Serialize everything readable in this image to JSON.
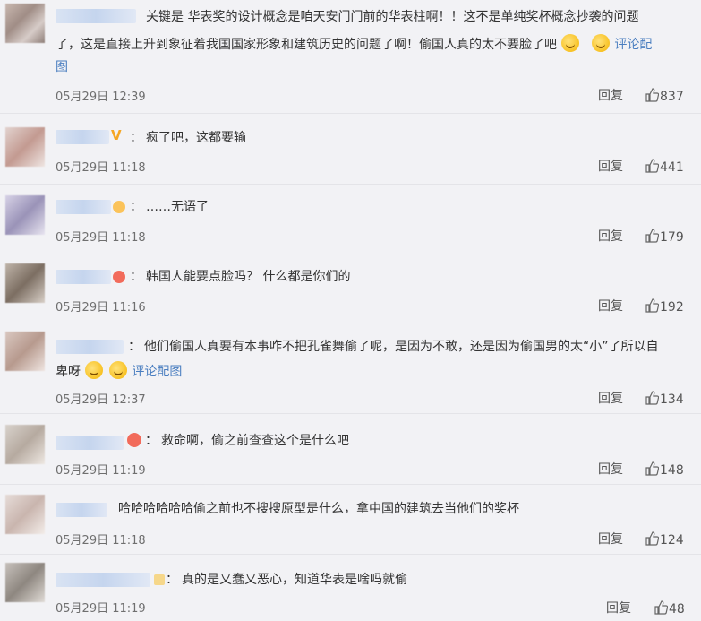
{
  "comments": [
    {
      "text": "关键是 华表奖的设计概念是咱天安门门前的华表柱啊！！这不是单纯奖杯概念抄袭的问题了，这是直接上升到象征着我国国家形象和建筑历史的问题了啊！偷国人真的太不要脸了吧",
      "line1": "关键是 华表奖的设计概念是咱天安门门前的华表柱啊！！这不是单纯奖杯概念抄袭的问题",
      "line2": "了，这是直接上升到象征着我国国家形象和建筑历史的问题了啊！偷国人真的太不要脸了吧",
      "pic_link_a": "评论配",
      "pic_link_b": "图",
      "time": "05月29日 12:39",
      "reply": "回复",
      "likes": "837"
    },
    {
      "prefix": "：",
      "text": "疯了吧，这都要输",
      "time": "05月29日 11:18",
      "reply": "回复",
      "likes": "441"
    },
    {
      "prefix": "：",
      "text": "……无语了",
      "time": "05月29日 11:18",
      "reply": "回复",
      "likes": "179"
    },
    {
      "prefix": "：",
      "text": "韩国人能要点脸吗？ 什么都是你们的",
      "time": "05月29日 11:16",
      "reply": "回复",
      "likes": "192"
    },
    {
      "prefix": "：",
      "line1": "他们偷国人真要有本事咋不把孔雀舞偷了呢，是因为不敢，还是因为偷国男的太“小”了所以自",
      "line2": "卑呀",
      "pic_link": "评论配图",
      "time": "05月29日 12:37",
      "reply": "回复",
      "likes": "134"
    },
    {
      "prefix": "：",
      "text": "救命啊，偷之前查查这个是什么吧",
      "time": "05月29日 11:19",
      "reply": "回复",
      "likes": "148"
    },
    {
      "text": "哈哈哈哈哈哈偷之前也不搜搜原型是什么，拿中国的建筑去当他们的奖杯",
      "time": "05月29日 11:18",
      "reply": "回复",
      "likes": "124"
    },
    {
      "prefix": "：",
      "text": "真的是又蠢又恶心，知道华表是啥吗就偷",
      "time": "05月29日 11:19",
      "reply": "回复",
      "likes": "48"
    }
  ],
  "icons": {
    "like": "thumbs-up-icon",
    "emoji": "smiley-emoji-icon",
    "badge": "user-badge-icon"
  },
  "colors": {
    "background": "#f2f2f5",
    "link": "#eb7350",
    "pic_link": "#4a7ec0"
  }
}
